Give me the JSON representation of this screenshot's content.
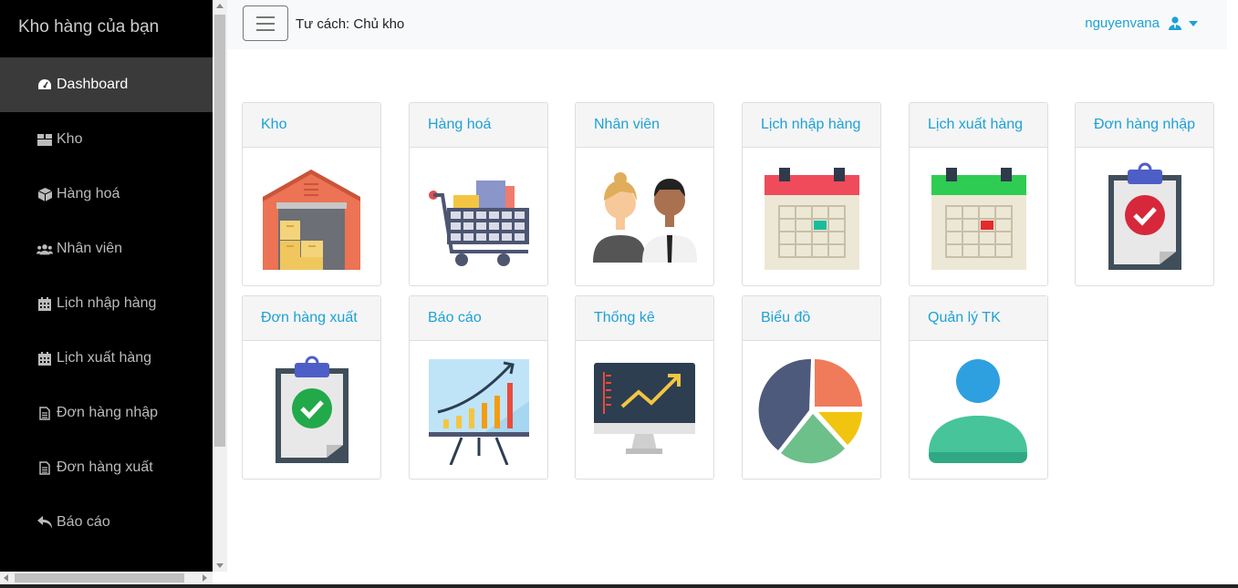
{
  "sidebar": {
    "brand": "Kho hàng của bạn",
    "items": [
      {
        "label": "Dashboard",
        "icon": "tachometer-icon",
        "active": true
      },
      {
        "label": "Kho",
        "icon": "boxes-icon"
      },
      {
        "label": "Hàng hoá",
        "icon": "cube-icon"
      },
      {
        "label": "Nhân viên",
        "icon": "users-icon"
      },
      {
        "label": "Lịch nhập hàng",
        "icon": "calendar-icon"
      },
      {
        "label": "Lịch xuất hàng",
        "icon": "calendar-icon"
      },
      {
        "label": "Đơn hàng nhập",
        "icon": "file-icon"
      },
      {
        "label": "Đơn hàng xuất",
        "icon": "file-icon"
      },
      {
        "label": "Báo cáo",
        "icon": "reply-icon"
      }
    ]
  },
  "topbar": {
    "role": "Tư cách: Chủ kho",
    "username": "nguyenvana"
  },
  "cards": [
    {
      "title": "Kho",
      "icon": "warehouse-icon"
    },
    {
      "title": "Hàng hoá",
      "icon": "shopping-cart-icon"
    },
    {
      "title": "Nhân viên",
      "icon": "employees-icon"
    },
    {
      "title": "Lịch nhập hàng",
      "icon": "import-calendar-icon"
    },
    {
      "title": "Lịch xuất hàng",
      "icon": "export-calendar-icon"
    },
    {
      "title": "Đơn hàng nhập",
      "icon": "import-order-clipboard-icon"
    },
    {
      "title": "Đơn hàng xuất",
      "icon": "export-order-clipboard-icon"
    },
    {
      "title": "Báo cáo",
      "icon": "report-chart-icon"
    },
    {
      "title": "Thống kê",
      "icon": "statistics-monitor-icon"
    },
    {
      "title": "Biểu đồ",
      "icon": "pie-chart-icon"
    },
    {
      "title": "Quản lý TK",
      "icon": "user-account-icon"
    }
  ],
  "colors": {
    "accent": "#1da1d6",
    "sidebar_bg": "#000000",
    "sidebar_active": "#3a3a3a"
  }
}
